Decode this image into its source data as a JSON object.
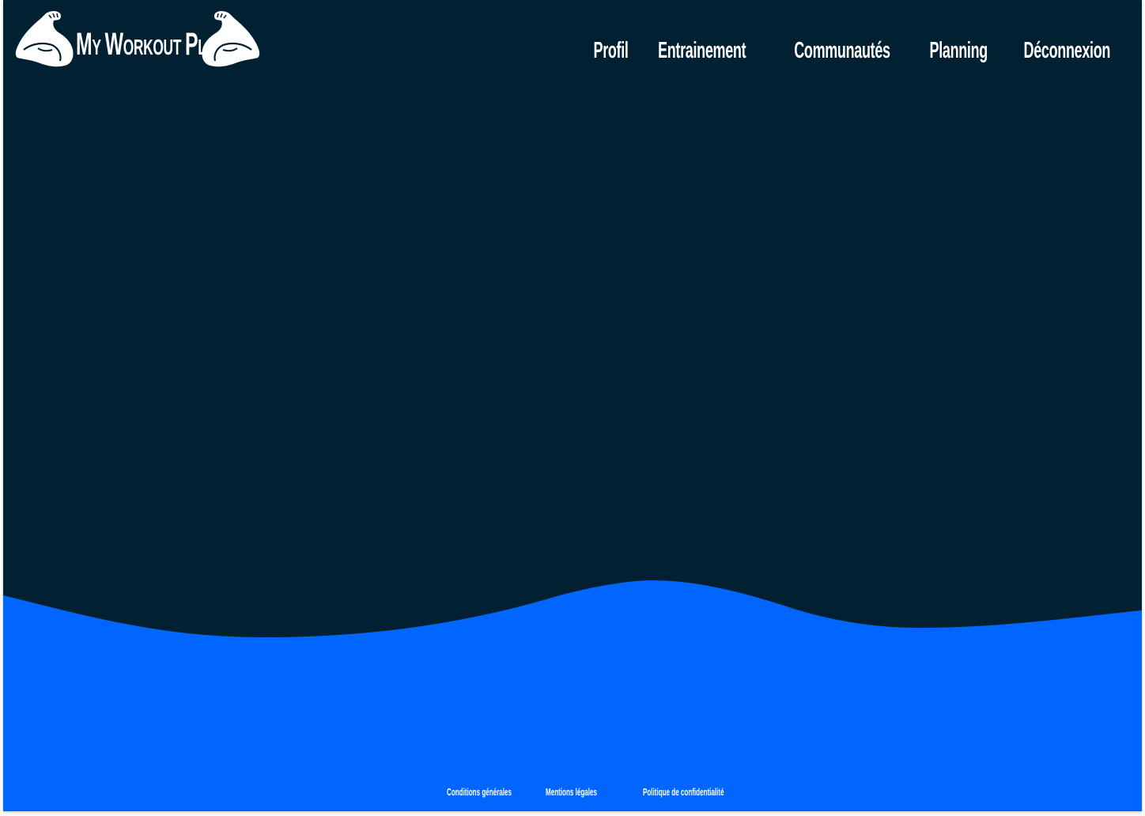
{
  "header": {
    "logo": {
      "word1_initial": "M",
      "word1_rest": "Y",
      "word2_initial": "W",
      "word2_rest": "ORKOUT",
      "word3_initial": "P",
      "word3_rest": "LAN",
      "left_icon": "flexed-arm-icon",
      "right_icon": "flexed-arm-icon"
    },
    "nav": {
      "profil": "Profil",
      "entrainement": "Entrainement",
      "communautes": "Communautés",
      "planning": "Planning",
      "deconnexion": "Déconnexion"
    }
  },
  "footer": {
    "conditions": "Conditions générales",
    "mentions": "Mentions légales",
    "politique": "Politique de confidentialité"
  },
  "colors": {
    "background": "#012133",
    "wave": "#0066ff",
    "text": "#ffffff"
  }
}
